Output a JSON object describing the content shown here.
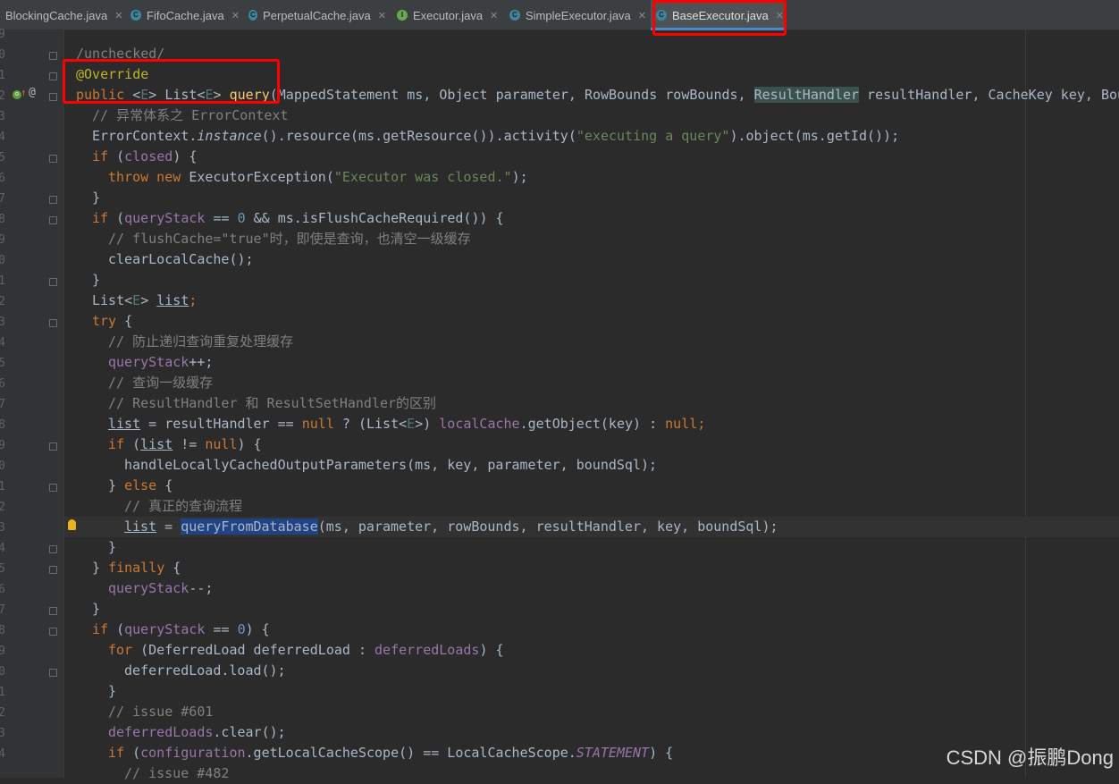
{
  "tabs": [
    {
      "label": "BlockingCache.java",
      "kind": "class",
      "active": false
    },
    {
      "label": "FifoCache.java",
      "kind": "class",
      "active": false
    },
    {
      "label": "PerpetualCache.java",
      "kind": "class",
      "active": false
    },
    {
      "label": "Executor.java",
      "kind": "interface",
      "active": false
    },
    {
      "label": "SimpleExecutor.java",
      "kind": "class",
      "active": false
    },
    {
      "label": "BaseExecutor.java",
      "kind": "class",
      "active": true
    }
  ],
  "icons": {
    "class": "C",
    "interface": "I",
    "close": "✕",
    "override_at": "@",
    "implements_up": "↑",
    "implemented": "o"
  },
  "line_number_digits": [
    "9",
    "0",
    "1",
    "2",
    "3",
    "4",
    "5",
    "6",
    "7",
    "8",
    "9",
    "0",
    "1",
    "2",
    "3",
    "4",
    "5",
    "6",
    "7",
    "8",
    "9",
    "0",
    "1",
    "2",
    "3",
    "4",
    "5",
    "6",
    "7",
    "8",
    "9",
    "0",
    "1",
    "2",
    "3",
    "4",
    "5",
    "6"
  ],
  "code": {
    "l1": "/unchecked/",
    "l2": "@Override",
    "l3": {
      "a": "public ",
      "b": "<",
      "c": "E",
      "d": "> List<",
      "e": "E",
      "f": "> ",
      "g": "query",
      "h": "(MappedStatement ms, Object parameter, RowBounds rowBounds, ",
      "i": "ResultHandler",
      "j": " resultHandler, CacheKey key, Bou"
    },
    "l4": "// 异常体系之 ErrorContext",
    "l5": {
      "a": "ErrorContext.",
      "b": "instance",
      "c": "().resource(ms.getResource()).activity(",
      "d": "\"executing a query\"",
      "e": ").object(ms.getId());"
    },
    "l6": {
      "a": "if ",
      "b": "(",
      "c": "closed",
      "d": ") {"
    },
    "l7": {
      "a": "throw new ",
      "b": "ExecutorException(",
      "c": "\"Executor was closed.\"",
      "d": ");"
    },
    "l8": "}",
    "l9": {
      "a": "if ",
      "b": "(",
      "c": "queryStack",
      "d": " == ",
      "e": "0",
      "f": " && ms.isFlushCacheRequired()) {"
    },
    "l10": "// flushCache=\"true\"时，即使是查询，也清空一级缓存",
    "l11": "clearLocalCache();",
    "l12": "}",
    "l13": {
      "a": "List<",
      "b": "E",
      "c": "> ",
      "d": "list",
      "e": ";"
    },
    "l14": {
      "a": "try ",
      "b": "{"
    },
    "l15": "// 防止递归查询重复处理缓存",
    "l16": {
      "a": "queryStack",
      "b": "++;"
    },
    "l17": "// 查询一级缓存",
    "l18": "// ResultHandler 和 ResultSetHandler的区别",
    "l19": {
      "a": "list",
      "b": " = resultHandler == ",
      "c": "null",
      "d": " ? (List<",
      "e": "E",
      "f": ">) ",
      "g": "localCache",
      "h": ".getObject(key) : ",
      "i": "null",
      "j": ";"
    },
    "l20": {
      "a": "if ",
      "b": "(",
      "c": "list",
      "d": " != ",
      "e": "null",
      "f": ") {"
    },
    "l21": "handleLocallyCachedOutputParameters(ms, key, parameter, boundSql);",
    "l22": {
      "a": "} ",
      "b": "else",
      "c": " {"
    },
    "l23": "// 真正的查询流程",
    "l24": {
      "a": "list",
      "b": " = ",
      "c": "queryFromDatabase",
      "d": "(ms, parameter, rowBounds, resultHandler, key, boundSql);"
    },
    "l25": "}",
    "l26": {
      "a": "} ",
      "b": "finally",
      "c": " {"
    },
    "l27": {
      "a": "queryStack",
      "b": "--;"
    },
    "l28": "}",
    "l29": {
      "a": "if ",
      "b": "(",
      "c": "queryStack",
      "d": " == ",
      "e": "0",
      "f": ") {"
    },
    "l30": {
      "a": "for ",
      "b": "(DeferredLoad deferredLoad : ",
      "c": "deferredLoads",
      "d": ") {"
    },
    "l31": "deferredLoad.load();",
    "l32": "}",
    "l33": "// issue #601",
    "l34": {
      "a": "deferredLoads",
      "b": ".clear();"
    },
    "l35": {
      "a": "if ",
      "b": "(",
      "c": "configuration",
      "d": ".getLocalCacheScope() == LocalCacheScope.",
      "e": "STATEMENT",
      "f": ") {"
    },
    "l36": "// issue #482"
  },
  "watermark": "CSDN @振鹏Dong"
}
